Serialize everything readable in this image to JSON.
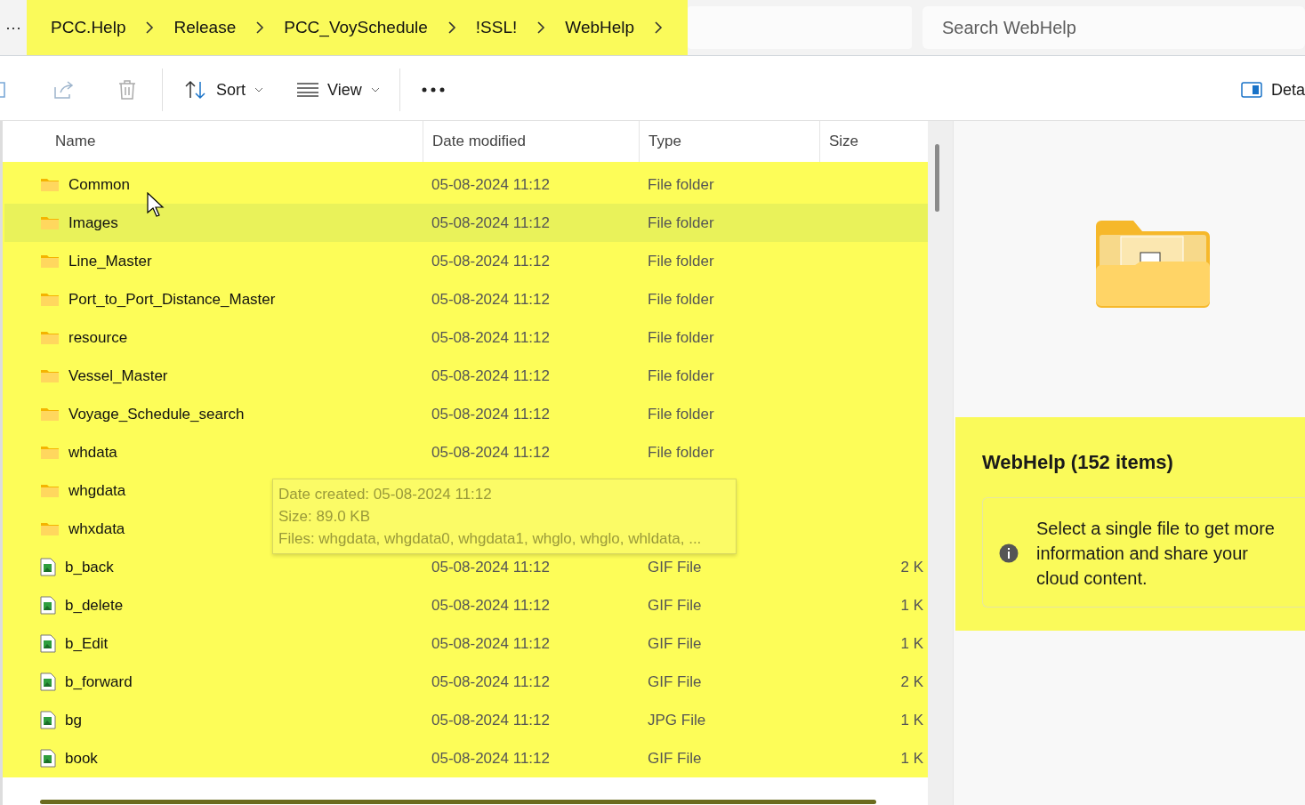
{
  "breadcrumb": {
    "more": "···",
    "highlighted": true,
    "items": [
      {
        "label": "PCC.Help"
      },
      {
        "label": "Release"
      },
      {
        "label": "PCC_VoySchedule"
      },
      {
        "label": "!SSL!"
      },
      {
        "label": "WebHelp"
      }
    ]
  },
  "search": {
    "placeholder": "Search WebHelp"
  },
  "toolbar": {
    "sort": "Sort",
    "view": "View",
    "details": "Deta"
  },
  "columns": [
    "Name",
    "Date modified",
    "Type",
    "Size"
  ],
  "list_highlighted": true,
  "files": [
    {
      "kind": "folder",
      "name": "Common",
      "date": "05-08-2024 11:12",
      "type": "File folder",
      "selected": false
    },
    {
      "kind": "folder",
      "name": "Images",
      "date": "05-08-2024 11:12",
      "type": "File folder",
      "selected": true
    },
    {
      "kind": "folder",
      "name": "Line_Master",
      "date": "05-08-2024 11:12",
      "type": "File folder",
      "selected": false
    },
    {
      "kind": "folder",
      "name": "Port_to_Port_Distance_Master",
      "date": "05-08-2024 11:12",
      "type": "File folder",
      "selected": false
    },
    {
      "kind": "folder",
      "name": "resource",
      "date": "05-08-2024 11:12",
      "type": "File folder",
      "selected": false
    },
    {
      "kind": "folder",
      "name": "Vessel_Master",
      "date": "05-08-2024 11:12",
      "type": "File folder",
      "selected": false
    },
    {
      "kind": "folder",
      "name": "Voyage_Schedule_search",
      "date": "05-08-2024 11:12",
      "type": "File folder",
      "selected": false
    },
    {
      "kind": "folder",
      "name": "whdata",
      "date": "05-08-2024 11:12",
      "type": "File folder",
      "selected": false
    },
    {
      "kind": "folder",
      "name": "whgdata",
      "selected": false
    },
    {
      "kind": "folder",
      "name": "whxdata",
      "selected": false
    },
    {
      "kind": "image",
      "name": "b_back",
      "date": "05-08-2024 11:12",
      "type": "GIF File",
      "size": "2 K",
      "selected": false
    },
    {
      "kind": "image",
      "name": "b_delete",
      "date": "05-08-2024 11:12",
      "type": "GIF File",
      "size": "1 K",
      "selected": false
    },
    {
      "kind": "image",
      "name": "b_Edit",
      "date": "05-08-2024 11:12",
      "type": "GIF File",
      "size": "1 K",
      "selected": false
    },
    {
      "kind": "image",
      "name": "b_forward",
      "date": "05-08-2024 11:12",
      "type": "GIF File",
      "size": "2 K",
      "selected": false
    },
    {
      "kind": "image",
      "name": "bg",
      "date": "05-08-2024 11:12",
      "type": "JPG File",
      "size": "1 K",
      "selected": false
    },
    {
      "kind": "image",
      "name": "book",
      "date": "05-08-2024 11:12",
      "type": "GIF File",
      "size": "1 K",
      "selected": false
    }
  ],
  "tooltip": {
    "lines": [
      "Date created: 05-08-2024 11:12",
      "Size: 89.0 KB",
      "Files: whgdata, whgdata0, whgdata1, whglo, whglo, whldata, ..."
    ]
  },
  "details": {
    "highlighted": true,
    "title": "WebHelp (152 items)",
    "info": "Select a single file to get more information and share your cloud content."
  }
}
